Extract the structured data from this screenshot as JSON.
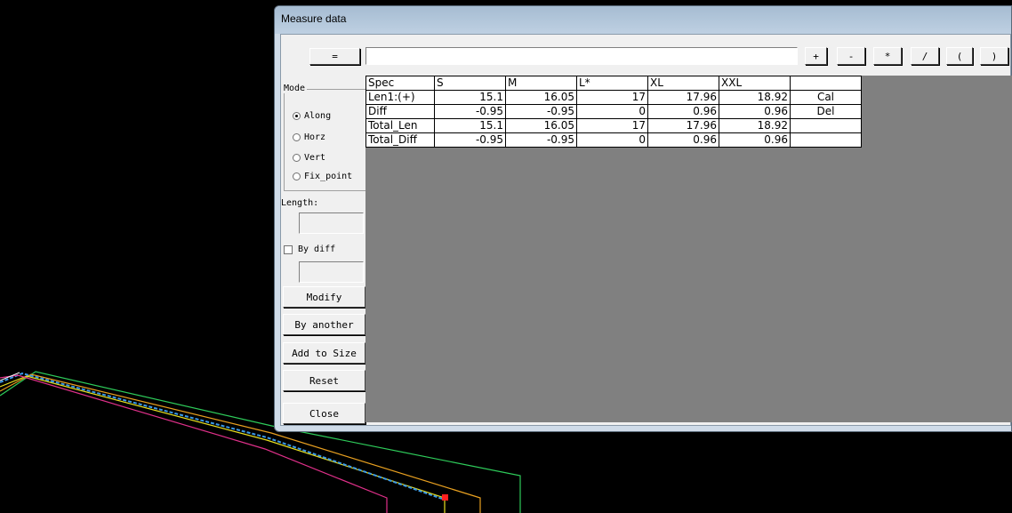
{
  "window": {
    "title": "Measure data"
  },
  "toolbar": {
    "equals": "=",
    "formula_value": "",
    "ops": [
      "+",
      "-",
      "*",
      "/",
      "(",
      ")"
    ]
  },
  "mode": {
    "label": "Mode",
    "options": [
      "Along",
      "Horz",
      "Vert",
      "Fix_point"
    ],
    "selected": "Along"
  },
  "length": {
    "label": "Length:",
    "value": ""
  },
  "by_diff": {
    "label": "By diff",
    "checked": false,
    "value": ""
  },
  "buttons": {
    "modify": "Modify",
    "by_another": "By another",
    "add_to_size": "Add to Size",
    "reset": "Reset",
    "close": "Close"
  },
  "table": {
    "headers": [
      "Spec",
      "S",
      "M",
      "L*",
      "XL",
      "XXL",
      ""
    ],
    "rows": [
      {
        "label": "Len1:(+)",
        "values": [
          "15.1",
          "16.05",
          "17",
          "17.96",
          "18.92"
        ],
        "action": "Cal"
      },
      {
        "label": "Diff",
        "values": [
          "-0.95",
          "-0.95",
          "0",
          "0.96",
          "0.96"
        ],
        "action": "Del"
      },
      {
        "label": "Total_Len",
        "values": [
          "15.1",
          "16.05",
          "17",
          "17.96",
          "18.92"
        ],
        "action": ""
      },
      {
        "label": "Total_Diff",
        "values": [
          "-0.95",
          "-0.95",
          "0",
          "0.96",
          "0.96"
        ],
        "action": ""
      }
    ]
  },
  "colors": {
    "canvas_bg": "#000000",
    "grid_bg": "#808080",
    "line_green": "#2ecc5a",
    "line_orange": "#e8a020",
    "line_yellow": "#e8e020",
    "line_magenta": "#e0308a",
    "line_blue": "#3a9ae8",
    "marker_red": "#ff2020"
  }
}
